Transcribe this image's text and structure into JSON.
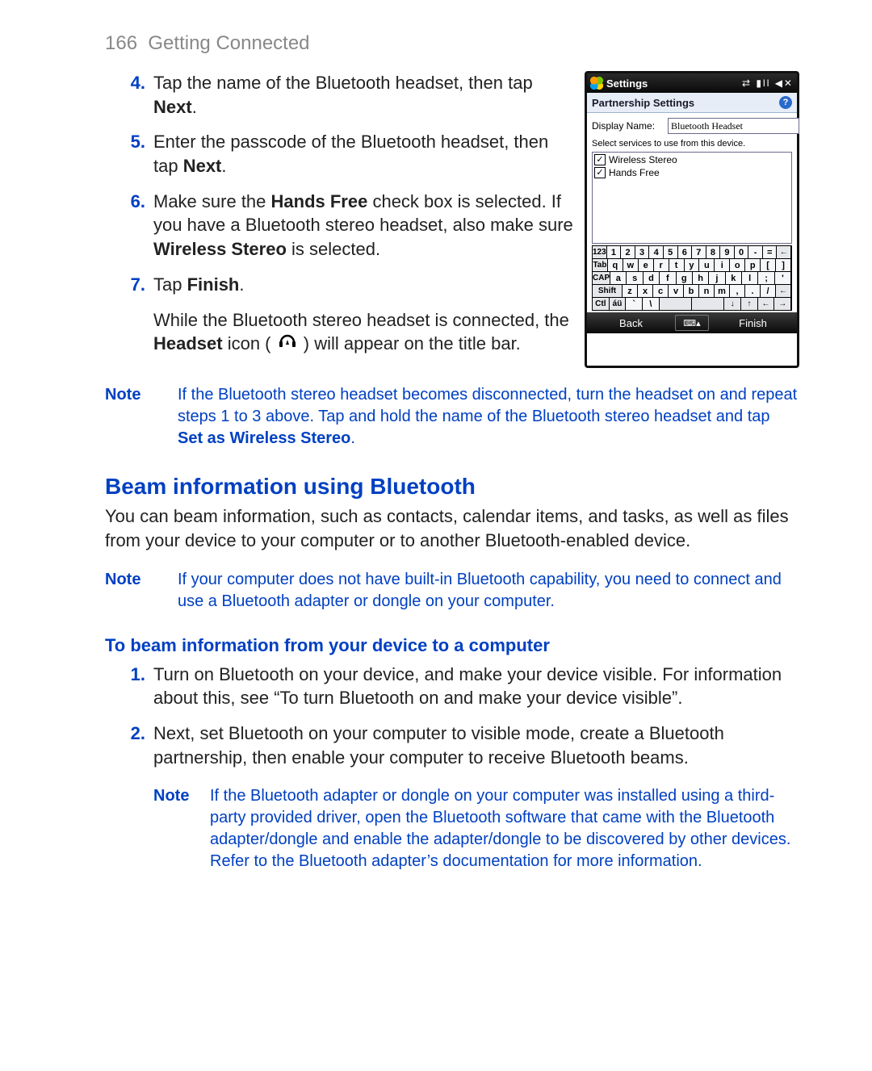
{
  "header": {
    "page_num": "166",
    "section": "Getting Connected"
  },
  "steps": {
    "s4": {
      "num": "4.",
      "t1": "Tap the name of the Bluetooth headset, then tap ",
      "b1": "Next",
      "t2": "."
    },
    "s5": {
      "num": "5.",
      "t1": "Enter the passcode of the Bluetooth headset, then tap ",
      "b1": "Next",
      "t2": "."
    },
    "s6": {
      "num": "6.",
      "t1": "Make sure the ",
      "b1": "Hands Free",
      "t2": " check box is selected. If you have a Bluetooth stereo headset, also make sure ",
      "b2": "Wireless Stereo",
      "t3": " is selected."
    },
    "s7": {
      "num": "7.",
      "t1": "Tap ",
      "b1": "Finish",
      "t2": "."
    },
    "s7b": {
      "t1": "While the Bluetooth stereo headset is connected, the ",
      "b1": "Headset",
      "t2": " icon ( ",
      "t3": " ) will appear on the title bar."
    }
  },
  "note1": {
    "label": "Note",
    "t1": "If the Bluetooth stereo headset becomes disconnected, turn the headset on and repeat steps 1 to 3 above. Tap and hold the name of the Bluetooth stereo headset and tap ",
    "b1": "Set as Wireless Stereo",
    "t2": "."
  },
  "beam": {
    "title": "Beam information using Bluetooth",
    "para": "You can beam information, such as contacts, calendar items, and tasks, as well as files from your device to your computer or to another Bluetooth-enabled device."
  },
  "note2": {
    "label": "Note",
    "text": "If your computer does not have built-in Bluetooth capability, you need to connect and use a Bluetooth adapter or dongle on your computer."
  },
  "proc": {
    "title": "To beam information from your device to a computer",
    "s1": {
      "num": "1.",
      "text": "Turn on Bluetooth on your device, and make your device visible. For information about this, see “To turn Bluetooth on and make your device visible”."
    },
    "s2": {
      "num": "2.",
      "text": "Next, set Bluetooth on your computer to visible mode, create a Bluetooth partnership, then enable your computer to receive Bluetooth beams."
    }
  },
  "note3": {
    "label": "Note",
    "text": "If the Bluetooth adapter or dongle on your computer was installed using a third-party provided driver, open the Bluetooth software that came with the Bluetooth adapter/dongle and enable the adapter/dongle to be discovered by other devices. Refer to the Bluetooth adapter’s documentation for more information."
  },
  "device": {
    "title": "Settings",
    "subtitle": "Partnership Settings",
    "display_label": "Display Name:",
    "display_value": "Bluetooth Headset",
    "hint": "Select services to use from this device.",
    "services": [
      "Wireless Stereo",
      "Hands Free"
    ],
    "kb": {
      "r1": [
        "123",
        "1",
        "2",
        "3",
        "4",
        "5",
        "6",
        "7",
        "8",
        "9",
        "0",
        "-",
        "=",
        "←"
      ],
      "r2": [
        "Tab",
        "q",
        "w",
        "e",
        "r",
        "t",
        "y",
        "u",
        "i",
        "o",
        "p",
        "[",
        "]"
      ],
      "r3": [
        "CAP",
        "a",
        "s",
        "d",
        "f",
        "g",
        "h",
        "j",
        "k",
        "l",
        ";",
        "'"
      ],
      "r4": [
        "Shift",
        "z",
        "x",
        "c",
        "v",
        "b",
        "n",
        "m",
        ",",
        ".",
        "/",
        "←"
      ],
      "r5": [
        "Ctl",
        "áü",
        "`",
        "\\",
        "↓",
        "↑",
        "←",
        "→"
      ]
    },
    "sk_left": "Back",
    "sk_right": "Finish",
    "sk_mid": "⌨▴"
  }
}
